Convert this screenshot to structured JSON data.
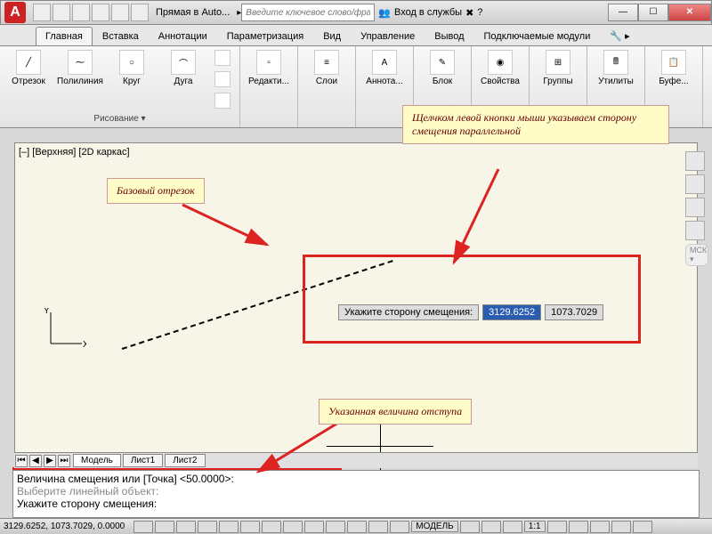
{
  "title": "Прямая в Auto...",
  "search_placeholder": "Введите ключевое слово/фразу",
  "signin": "Вход в службы",
  "tabs": [
    "Главная",
    "Вставка",
    "Аннотации",
    "Параметризация",
    "Вид",
    "Управление",
    "Вывод",
    "Подключаемые модули"
  ],
  "ribbon": {
    "draw": {
      "line": "Отрезок",
      "polyline": "Полилиния",
      "circle": "Круг",
      "arc": "Дуга",
      "title": "Рисование ▾"
    },
    "edit": "Редакти...",
    "layers": "Слои",
    "annot": "Аннота...",
    "block": "Блок",
    "props": "Свойства",
    "groups": "Группы",
    "utils": "Утилиты",
    "clip": "Буфе..."
  },
  "viewport_label": "[–] [Верхняя] [2D каркас]",
  "callouts": {
    "c1": "Базовый отрезок",
    "c2": "Щелчком левой кнопки мыши указываем сторону смещения параллельной",
    "c3": "Указанная величина отступа"
  },
  "dyn": {
    "label": "Укажите сторону смещения:",
    "x": "3129.6252",
    "y": "1073.7029"
  },
  "layout_tabs": [
    "Модель",
    "Лист1",
    "Лист2"
  ],
  "cmd": {
    "l1": "Величина смещения или [Точка] <50.0000>:",
    "l2": "Выберите линейный объект:",
    "l3": "Укажите сторону смещения:"
  },
  "status": {
    "coords": "3129.6252, 1073.7029, 0.0000",
    "model": "МОДЕЛЬ",
    "scale": "1:1"
  },
  "ucs": {
    "x": "X",
    "y": "Y"
  },
  "mck": "МСК ▾"
}
